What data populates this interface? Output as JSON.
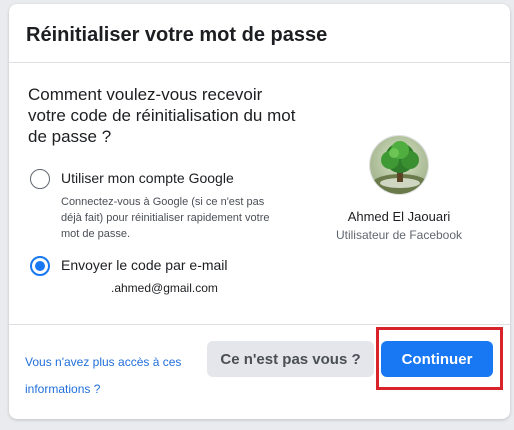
{
  "dialog": {
    "title": "Réinitialiser votre mot de passe",
    "question": "Comment voulez-vous recevoir votre code de réinitialisation du mot de passe ?"
  },
  "options": [
    {
      "label": "Utiliser mon compte Google",
      "description": "Connectez-vous à Google (si ce n'est pas déjà fait) pour réinitialiser rapidement votre mot de passe.",
      "selected": false
    },
    {
      "label": "Envoyer le code par e-mail",
      "detail": ".ahmed@gmail.com",
      "selected": true
    }
  ],
  "profile": {
    "name": "Ahmed El Jaouari",
    "subtitle": "Utilisateur de Facebook",
    "avatar_icon": "tree-profile-photo"
  },
  "footer": {
    "link_text": "Vous n'avez plus accès à ces informations ?",
    "secondary_button": "Ce n'est pas vous ?",
    "primary_button": "Continuer"
  },
  "colors": {
    "primary": "#1877f2",
    "link": "#216fdb",
    "highlight": "#d9232a"
  }
}
